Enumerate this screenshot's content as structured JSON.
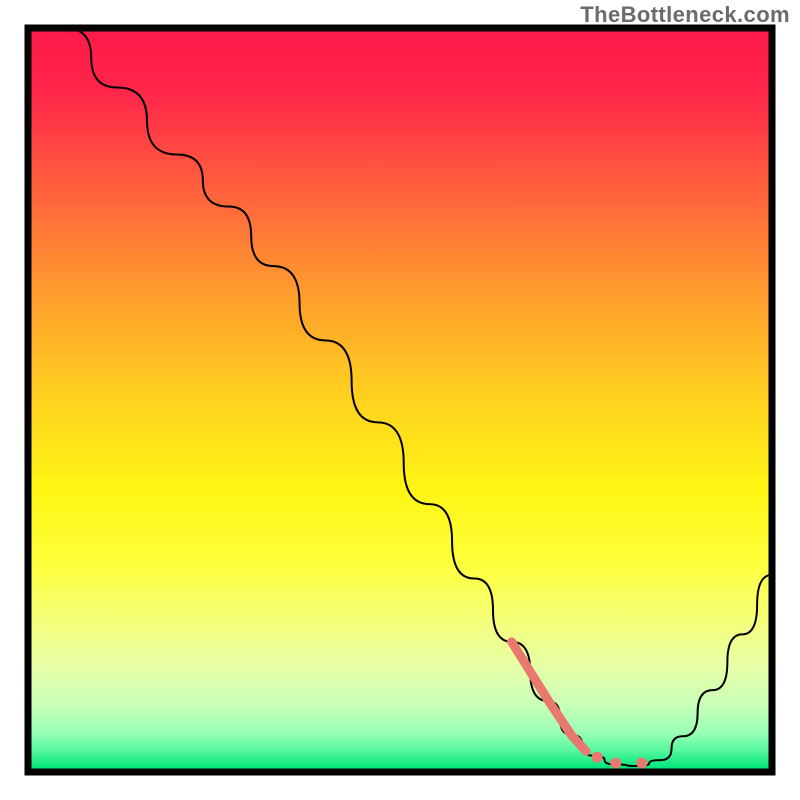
{
  "watermark": "TheBottleneck.com",
  "chart_data": {
    "type": "line",
    "title": "",
    "xlabel": "",
    "ylabel": "",
    "xlim": [
      0,
      100
    ],
    "ylim": [
      0,
      100
    ],
    "background_gradient": {
      "stops": [
        {
          "offset": 0.0,
          "color": "#ff1a4b"
        },
        {
          "offset": 0.08,
          "color": "#ff254a"
        },
        {
          "offset": 0.2,
          "color": "#ff5a3e"
        },
        {
          "offset": 0.35,
          "color": "#ff9a2e"
        },
        {
          "offset": 0.5,
          "color": "#ffd21f"
        },
        {
          "offset": 0.62,
          "color": "#fff514"
        },
        {
          "offset": 0.72,
          "color": "#fdff3a"
        },
        {
          "offset": 0.8,
          "color": "#f4ff7a"
        },
        {
          "offset": 0.86,
          "color": "#e7ffa6"
        },
        {
          "offset": 0.91,
          "color": "#ccffb8"
        },
        {
          "offset": 0.95,
          "color": "#9dffb6"
        },
        {
          "offset": 0.975,
          "color": "#58f8a0"
        },
        {
          "offset": 1.0,
          "color": "#00e57a"
        }
      ]
    },
    "series": [
      {
        "name": "bottleneck-curve",
        "stroke": "#000000",
        "stroke_width": 2,
        "points": [
          {
            "x": 5,
            "y": 100
          },
          {
            "x": 12,
            "y": 92
          },
          {
            "x": 20,
            "y": 83
          },
          {
            "x": 27,
            "y": 76
          },
          {
            "x": 33,
            "y": 68
          },
          {
            "x": 40,
            "y": 58
          },
          {
            "x": 47,
            "y": 47
          },
          {
            "x": 54,
            "y": 36
          },
          {
            "x": 60,
            "y": 26
          },
          {
            "x": 65,
            "y": 17.5
          },
          {
            "x": 70,
            "y": 9.5
          },
          {
            "x": 73,
            "y": 5.0
          },
          {
            "x": 76,
            "y": 2.2
          },
          {
            "x": 79,
            "y": 1.0
          },
          {
            "x": 82,
            "y": 0.8
          },
          {
            "x": 85,
            "y": 1.6
          },
          {
            "x": 88,
            "y": 4.8
          },
          {
            "x": 92,
            "y": 11.0
          },
          {
            "x": 96,
            "y": 18.5
          },
          {
            "x": 100,
            "y": 26.5
          }
        ]
      },
      {
        "name": "highlight-segment",
        "stroke": "#e9796f",
        "stroke_width": 9,
        "points": [
          {
            "x": 65,
            "y": 17.5
          },
          {
            "x": 70,
            "y": 9.5
          },
          {
            "x": 73,
            "y": 5.0
          },
          {
            "x": 75,
            "y": 2.8
          }
        ]
      }
    ],
    "dots": {
      "color": "#e9796f",
      "radius": 5.5,
      "points": [
        {
          "x": 76.5,
          "y": 2.0
        },
        {
          "x": 79.0,
          "y": 1.2
        },
        {
          "x": 82.5,
          "y": 1.2
        }
      ]
    }
  }
}
